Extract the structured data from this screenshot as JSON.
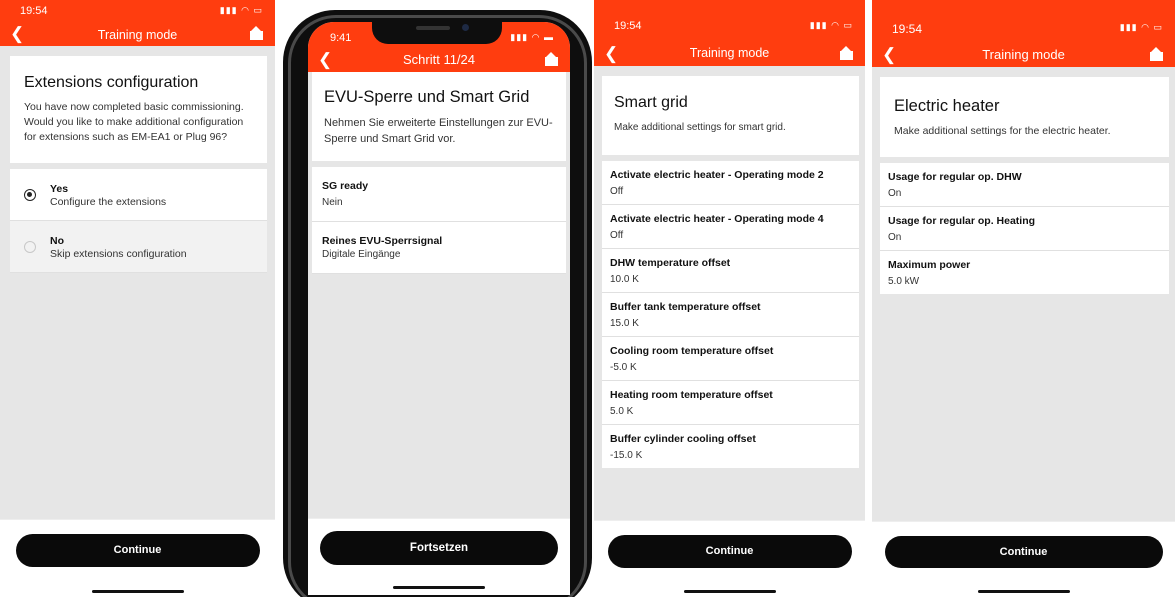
{
  "colors": {
    "accent": "#ff3d0f",
    "button": "#0a0a0a",
    "background": "#e6e6e6"
  },
  "screen1": {
    "status_time": "19:54",
    "nav_title": "Training mode",
    "heading": "Extensions configuration",
    "description": "You have now completed basic commissioning. Would you like to make additional configuration for extensions such as EM-EA1 or Plug 96?",
    "options": [
      {
        "label": "Yes",
        "sub": "Configure the extensions",
        "selected": true
      },
      {
        "label": "No",
        "sub": "Skip extensions configuration",
        "selected": false
      }
    ],
    "button": "Continue"
  },
  "screen2": {
    "status_time": "9:41",
    "nav_title": "Schritt 11/24",
    "heading": "EVU-Sperre und Smart Grid",
    "description": "Nehmen Sie erweiterte Einstellungen zur EVU-Sperre und Smart Grid vor.",
    "items": [
      {
        "label": "SG ready",
        "value": "Nein"
      },
      {
        "label": "Reines EVU-Sperrsignal",
        "value": "Digitale Eingänge"
      }
    ],
    "button": "Fortsetzen"
  },
  "screen3": {
    "status_time": "19:54",
    "nav_title": "Training mode",
    "heading": "Smart grid",
    "description": "Make additional settings for smart grid.",
    "items": [
      {
        "label": "Activate electric heater - Operating mode 2",
        "value": "Off"
      },
      {
        "label": "Activate electric heater - Operating mode 4",
        "value": "Off"
      },
      {
        "label": "DHW temperature offset",
        "value": "10.0 K"
      },
      {
        "label": "Buffer tank temperature offset",
        "value": "15.0 K"
      },
      {
        "label": "Cooling room temperature offset",
        "value": "-5.0 K"
      },
      {
        "label": "Heating room temperature offset",
        "value": "5.0 K"
      },
      {
        "label": "Buffer cylinder cooling offset",
        "value": "-15.0 K"
      }
    ],
    "button": "Continue"
  },
  "screen4": {
    "status_time": "19:54",
    "nav_title": "Training mode",
    "heading": "Electric heater",
    "description": "Make additional settings for the electric heater.",
    "items": [
      {
        "label": "Usage for regular op. DHW",
        "value": "On"
      },
      {
        "label": "Usage for regular op. Heating",
        "value": "On"
      },
      {
        "label": "Maximum power",
        "value": "5.0 kW"
      }
    ],
    "button": "Continue"
  }
}
